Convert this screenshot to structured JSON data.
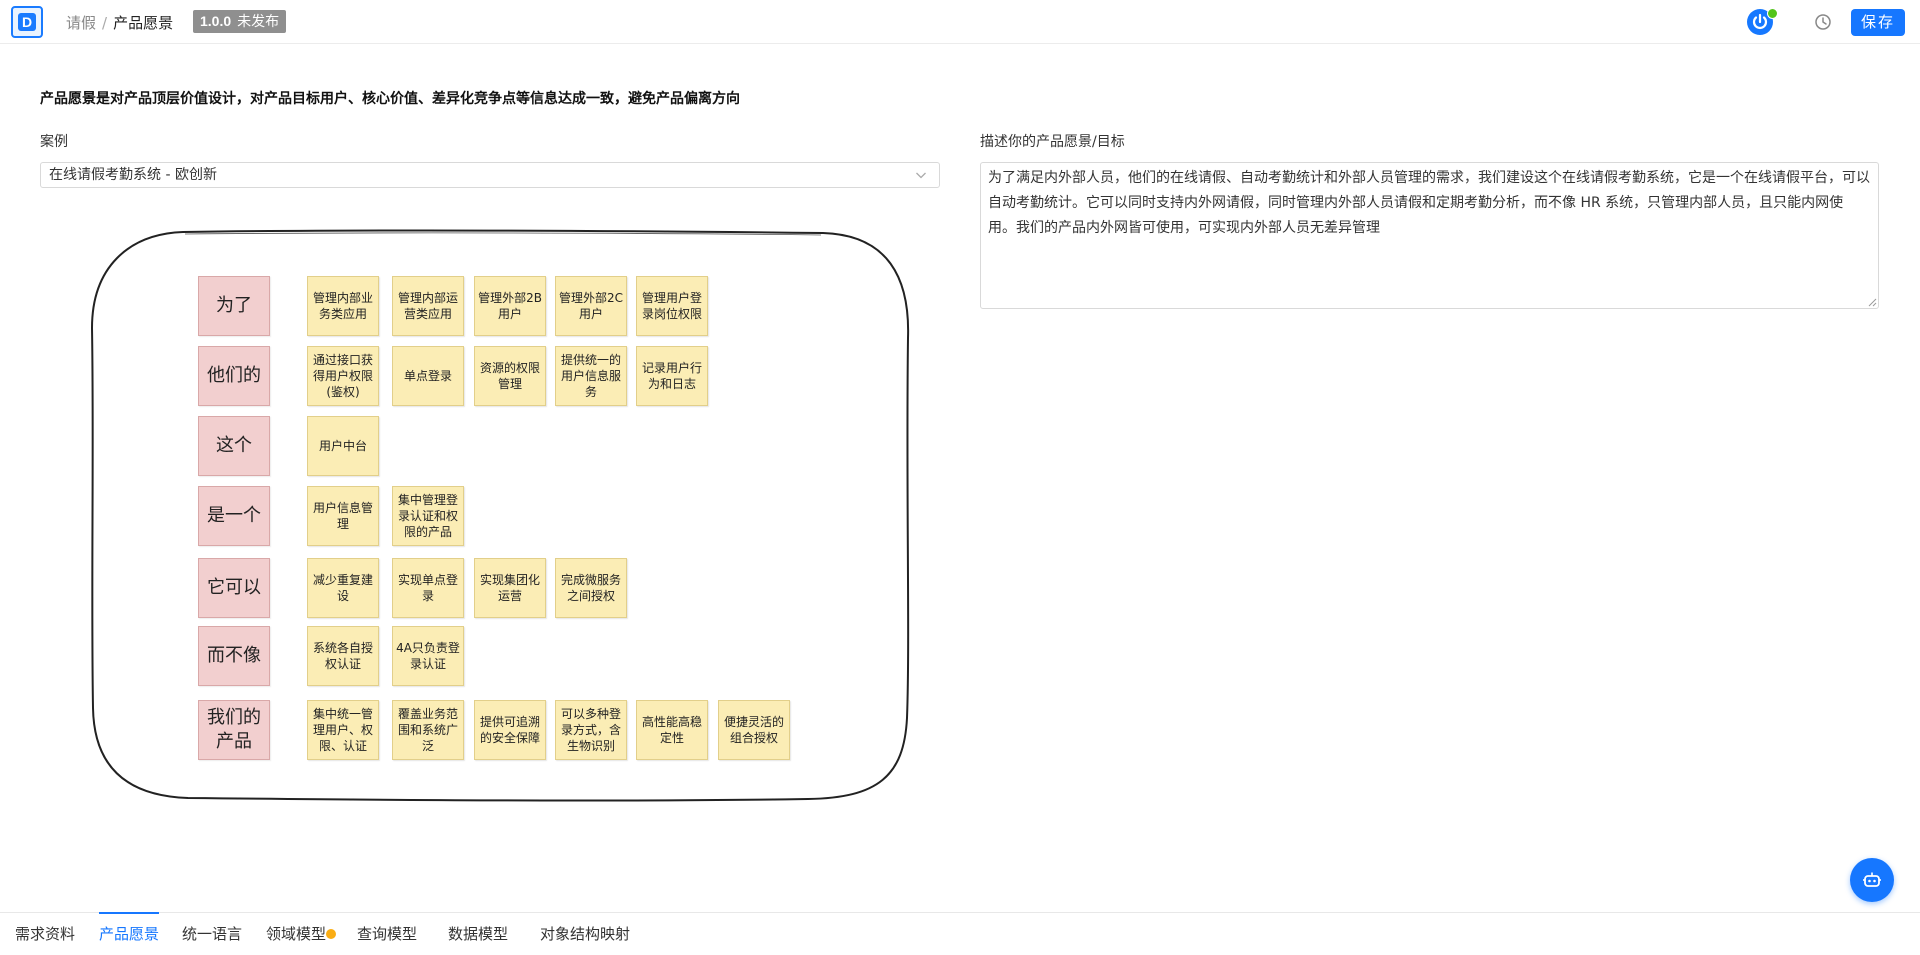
{
  "header": {
    "breadcrumb_parent": "请假",
    "breadcrumb_separator": "/",
    "breadcrumb_current": "产品愿景",
    "version_number": "1.0.0",
    "version_status": "未发布",
    "save_label": "保存",
    "status_color": "#52c41a",
    "accent_color": "#1677ff"
  },
  "intro": "产品愿景是对产品顶层价值设计，对产品目标用户、核心价值、差异化竞争点等信息达成一致，避免产品偏离方向",
  "example": {
    "label": "案例",
    "selected": "在线请假考勤系统 - 欧创新"
  },
  "vision": {
    "label": "描述你的产品愿景/目标",
    "text": "为了满足内外部人员，他们的在线请假、自动考勤统计和外部人员管理的需求，我们建设这个在线请假考勤系统，它是一个在线请假平台，可以自动考勤统计。它可以同时支持内外网请假，同时管理内外部人员请假和定期考勤分析，而不像 HR 系统，只管理内部人员，且只能内网使用。我们的产品内外网皆可使用，可实现内外部人员无差异管理"
  },
  "board": {
    "rows": [
      {
        "label": "为了",
        "notes": [
          "管理内部业务类应用",
          "管理内部运营类应用",
          "管理外部2B用户",
          "管理外部2C用户",
          "管理用户登录岗位权限"
        ]
      },
      {
        "label": "他们的",
        "notes": [
          "通过接口获得用户权限(鉴权)",
          "单点登录",
          "资源的权限管理",
          "提供统一的用户信息服务",
          "记录用户行为和日志"
        ]
      },
      {
        "label": "这个",
        "notes": [
          "用户中台"
        ]
      },
      {
        "label": "是一个",
        "notes": [
          "用户信息管理",
          "集中管理登录认证和权限的产品"
        ]
      },
      {
        "label": "它可以",
        "notes": [
          "减少重复建设",
          "实现单点登录",
          "实现集团化运营",
          "完成微服务之间授权"
        ]
      },
      {
        "label": "而不像",
        "notes": [
          "系统各自授权认证",
          "4A只负责登录认证"
        ]
      },
      {
        "label": "我们的产品",
        "notes": [
          "集中统一管理用户、权限、认证",
          "覆盖业务范围和系统广泛",
          "提供可追溯的安全保障",
          "可以多种登录方式，含生物识别",
          "高性能高稳定性",
          "便捷灵活的组合授权"
        ]
      }
    ]
  },
  "tabs": [
    {
      "label": "需求资料",
      "active": false,
      "dot": false
    },
    {
      "label": "产品愿景",
      "active": true,
      "dot": false
    },
    {
      "label": "统一语言",
      "active": false,
      "dot": false
    },
    {
      "label": "领域模型",
      "active": false,
      "dot": true
    },
    {
      "label": "查询模型",
      "active": false,
      "dot": false
    },
    {
      "label": "数据模型",
      "active": false,
      "dot": false
    },
    {
      "label": "对象结构映射",
      "active": false,
      "dot": false
    }
  ]
}
